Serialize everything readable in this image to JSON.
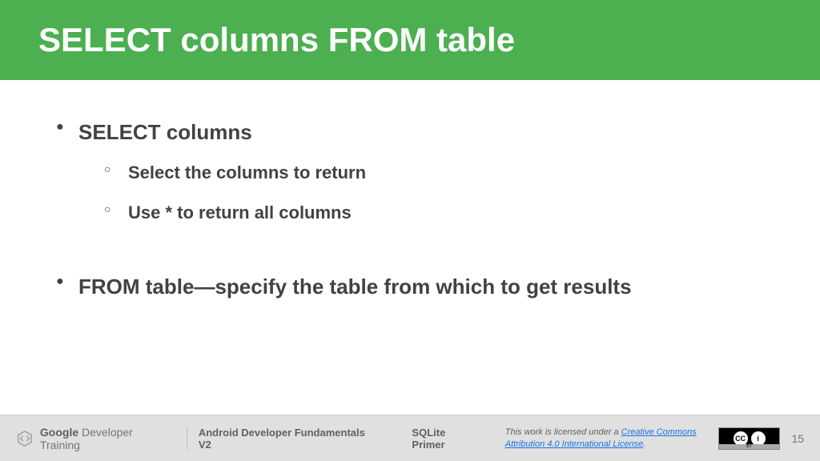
{
  "header": {
    "title": "SELECT columns FROM table"
  },
  "bullets": {
    "b1": "SELECT columns",
    "b1a": "Select the columns to return",
    "b1b": "Use * to return all columns",
    "b2": "FROM table—specify the table from which to get results"
  },
  "footer": {
    "logo_bold": "Google",
    "logo_rest": " Developer Training",
    "course": "Android Developer Fundamentals V2",
    "section": "SQLite Primer",
    "license_pre": "This work is licensed under a ",
    "license_link": "Creative Commons Attribution 4.0 International License",
    "license_post": ".",
    "cc": "CC",
    "by_icon": "i",
    "by_label": "BY",
    "page": "15"
  },
  "colors": {
    "accent": "#4caf50",
    "link": "#1a73e8"
  }
}
